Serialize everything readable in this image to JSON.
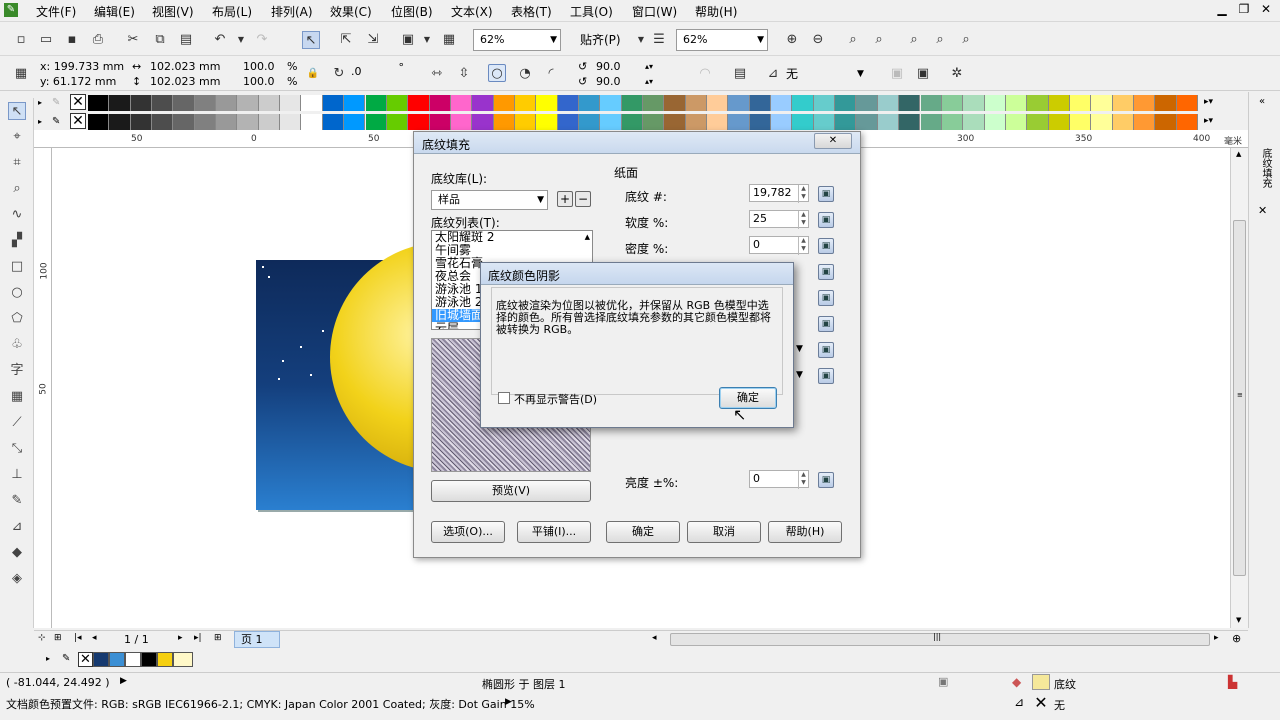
{
  "menu": [
    "文件(F)",
    "编辑(E)",
    "视图(V)",
    "布局(L)",
    "排列(A)",
    "效果(C)",
    "位图(B)",
    "文本(X)",
    "表格(T)",
    "工具(O)",
    "窗口(W)",
    "帮助(H)"
  ],
  "window_controls": {
    "minimize": "▁",
    "restore": "❐",
    "close": "✕"
  },
  "toolbar": {
    "zoom1": "62%",
    "snap": "贴齐(P)",
    "zoom2": "62%"
  },
  "props": {
    "x": "x: 199.733 mm",
    "y": "y: 61.172 mm",
    "w": "102.023 mm",
    "h": "102.023 mm",
    "sx": "100.0",
    "sy": "100.0",
    "pct": "%",
    "angle": ".0",
    "deg": "°",
    "a1": "90.0",
    "a2": "90.0",
    "outline": "无"
  },
  "ruler_h": [
    "50",
    "0",
    "50",
    "300",
    "350",
    "400",
    "毫米"
  ],
  "ruler_v": [
    "100",
    "50"
  ],
  "page_nav": {
    "count": "1 / 1",
    "tab": "页 1"
  },
  "dialog": {
    "title": "底纹填充",
    "lib_label": "底纹库(L):",
    "lib_value": "样品",
    "list_label": "底纹列表(T):",
    "list_items": [
      "太阳耀斑 2",
      "午间雾",
      "雪花石膏",
      "夜总会",
      "游泳池 1",
      "游泳池 2",
      "旧城墙面",
      "云层"
    ],
    "selected_index": 6,
    "section": "纸面",
    "fields": [
      {
        "label": "底纹 #:",
        "value": "19,782"
      },
      {
        "label": "软度 %:",
        "value": "25"
      },
      {
        "label": "密度 %:",
        "value": "0"
      }
    ],
    "brightness_label": "亮度 ±%:",
    "brightness_value": "0",
    "preview_btn": "预览(V)",
    "options_btn": "选项(O)...",
    "tile_btn": "平铺(I)...",
    "ok_btn": "确定",
    "cancel_btn": "取消",
    "help_btn": "帮助(H)"
  },
  "alert": {
    "title": "底纹颜色阴影",
    "message": "底纹被渲染为位图以被优化，并保留从 RGB 色模型中选择的颜色。所有曾选择底纹填充参数的其它颜色模型都将被转换为 RGB。",
    "checkbox": "不再显示警告(D)",
    "ok": "确定"
  },
  "status": {
    "coords": "( -81.044, 24.492 )",
    "object": "椭圆形 于 图层 1",
    "fill": "底纹",
    "outline": "无",
    "profile": "文档颜色预置文件: RGB: sRGB IEC61966-2.1; CMYK: Japan Color 2001 Coated; 灰度: Dot Gain 15%"
  },
  "right_dock_label": "底纹填充",
  "colors": {
    "accent": "#3399ff",
    "sun": "#f2d21a",
    "sky_top": "#0e2a5a",
    "sky_bottom": "#2a7fd0"
  }
}
